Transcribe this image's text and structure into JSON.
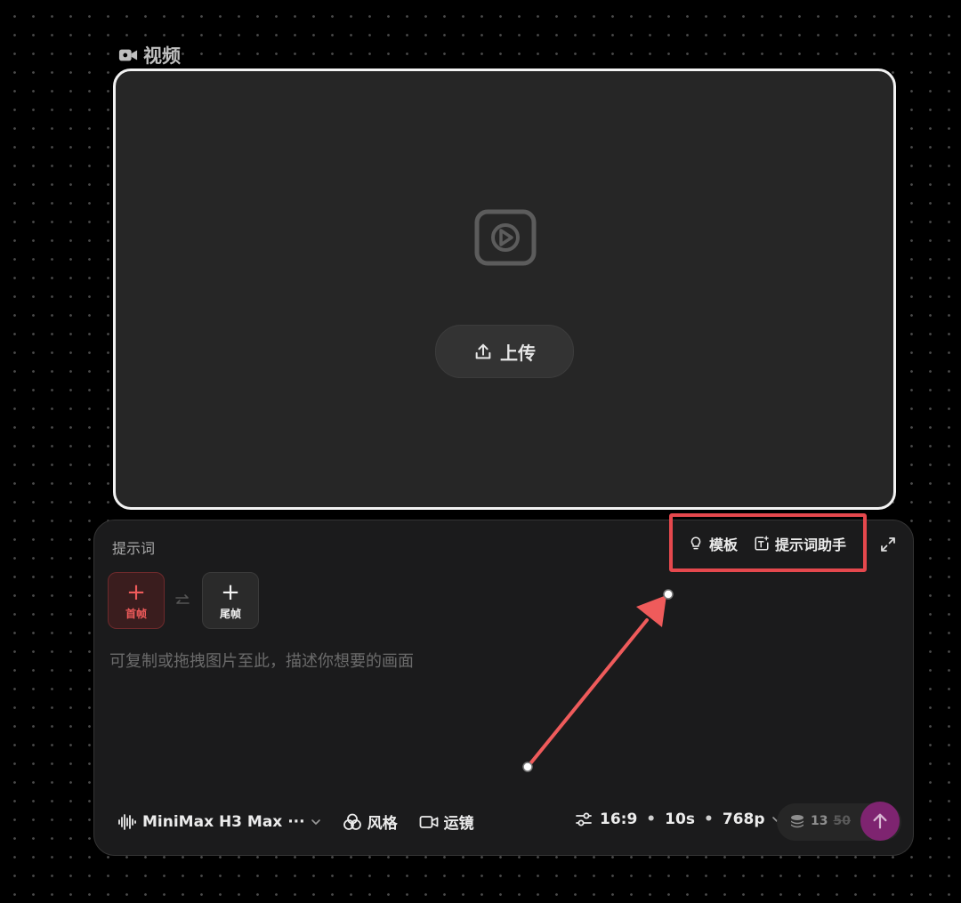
{
  "node": {
    "label": "视频",
    "icon": "video-camera-icon"
  },
  "video_card": {
    "upload_label": "上传",
    "play_icon": "play-icon",
    "upload_icon": "upload-icon"
  },
  "prompt": {
    "title": "提示词",
    "template_label": "模板",
    "assistant_label": "提示词助手",
    "first_frame_label": "首帧",
    "last_frame_label": "尾帧",
    "placeholder": "可复制或拖拽图片至此，描述你想要的画面",
    "value": ""
  },
  "toolbar": {
    "model_name": "MiniMax H3 Max ···",
    "style_label": "风格",
    "camera_label": "运镜",
    "aspect_ratio": "16:9",
    "duration": "10s",
    "resolution": "768p",
    "separator": "•",
    "credits": "13",
    "credits_original": "50"
  },
  "colors": {
    "highlight": "#e5484d",
    "send_button": "#7e2470",
    "first_frame_accent": "#ef5b5b"
  }
}
